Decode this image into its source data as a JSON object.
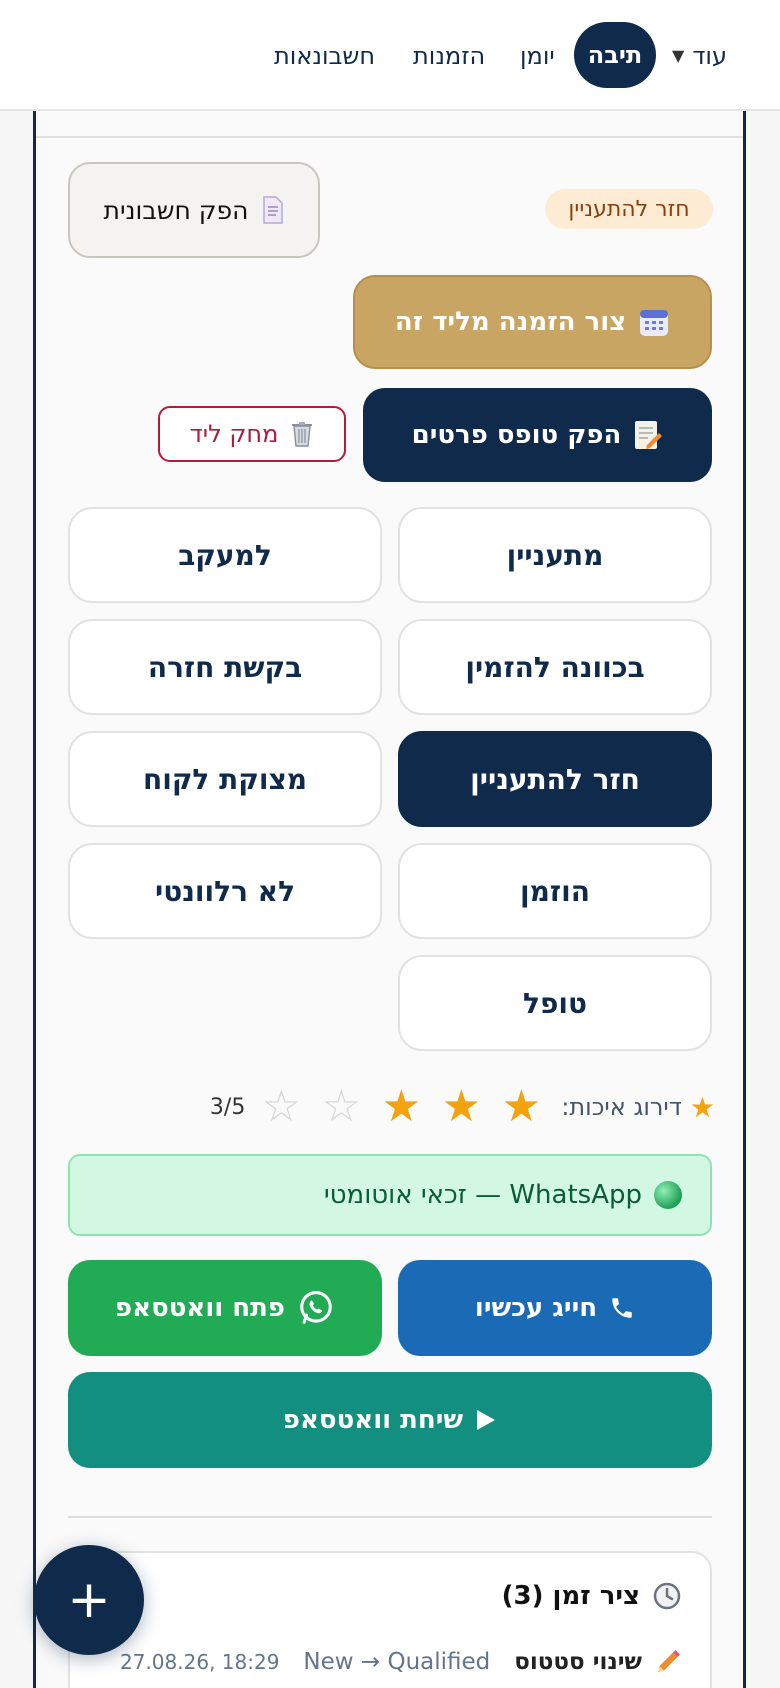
{
  "nav": {
    "more": "עוד",
    "box": "תיבה",
    "calendar": "יומן",
    "orders": "הזמנות",
    "accounts": "חשבונאות"
  },
  "lead": {
    "status_chip": "חזר להתעניין",
    "invoice_btn": "הפק חשבונית",
    "create_order_btn": "צור הזמנה מליד זה",
    "form_btn": "הפק טופס פרטים",
    "delete_btn": "מחק ליד"
  },
  "status_options": [
    {
      "label": "מתעניין",
      "active": false
    },
    {
      "label": "למעקב",
      "active": false
    },
    {
      "label": "בכוונה להזמין",
      "active": false
    },
    {
      "label": "בקשת חזרה",
      "active": false
    },
    {
      "label": "חזר להתעניין",
      "active": true
    },
    {
      "label": "מצוקת לקוח",
      "active": false
    },
    {
      "label": "הוזמן",
      "active": false
    },
    {
      "label": "לא רלוונטי",
      "active": false
    },
    {
      "label": "טופל",
      "active": false
    }
  ],
  "rating": {
    "label": "דירוג איכות:",
    "value": 3,
    "max": 5,
    "display": "3/5"
  },
  "whatsapp": {
    "banner": "WhatsApp — זכאי אוטומטי",
    "call_btn": "חייג עכשיו",
    "open_btn": "פתח וואטסאפ",
    "chat_btn": "שיחת וואטסאפ"
  },
  "timeline": {
    "title": "ציר זמן (3)",
    "entries": [
      {
        "type": "שינוי סטטוס",
        "change": "New → Qualified",
        "time": "27.08.26, 18:29"
      }
    ]
  },
  "fab": {
    "label": "+"
  },
  "colors": {
    "navy": "#0f2a4a",
    "gold": "#c9a564",
    "call_blue": "#1b6ab6",
    "whatsapp_green": "#22ab55",
    "teal": "#138f80",
    "danger": "#b11b3c"
  }
}
